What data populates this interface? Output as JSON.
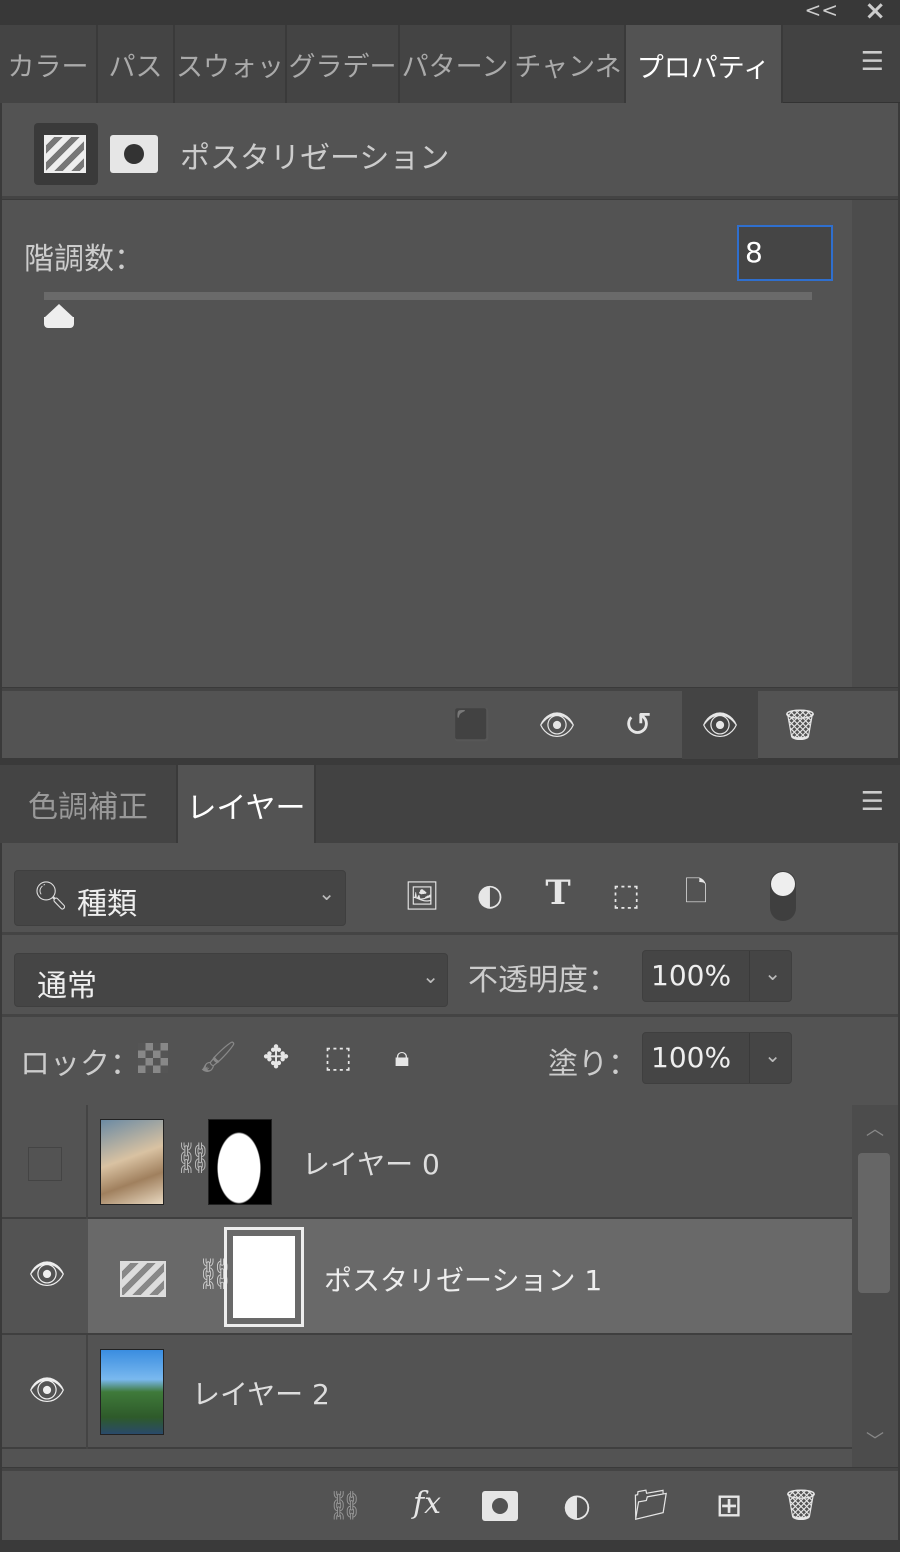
{
  "window": {
    "collapse": "<<",
    "close": "×"
  },
  "top_tabs": [
    {
      "label": "カラー"
    },
    {
      "label": "パス"
    },
    {
      "label": "スウォッ"
    },
    {
      "label": "グラデー"
    },
    {
      "label": "パターン"
    },
    {
      "label": "チャンネ"
    },
    {
      "label": "プロパティ",
      "active": true
    }
  ],
  "properties": {
    "title": "ポスタリゼーション",
    "levels_label": "階調数：",
    "levels_value": "8",
    "levels_fraction": 0.0
  },
  "layer_tabs": [
    {
      "label": "色調補正"
    },
    {
      "label": "レイヤー",
      "active": true
    }
  ],
  "filter": {
    "kind": "種類"
  },
  "blend": {
    "mode": "通常",
    "opacity_label": "不透明度：",
    "opacity": "100%"
  },
  "lock": {
    "label": "ロック：",
    "fill_label": "塗り：",
    "fill": "100%"
  },
  "layers": [
    {
      "name": "レイヤー 0",
      "visible": false
    },
    {
      "name": "ポスタリゼーション 1",
      "visible": true,
      "selected": true
    },
    {
      "name": "レイヤー 2",
      "visible": true
    }
  ]
}
